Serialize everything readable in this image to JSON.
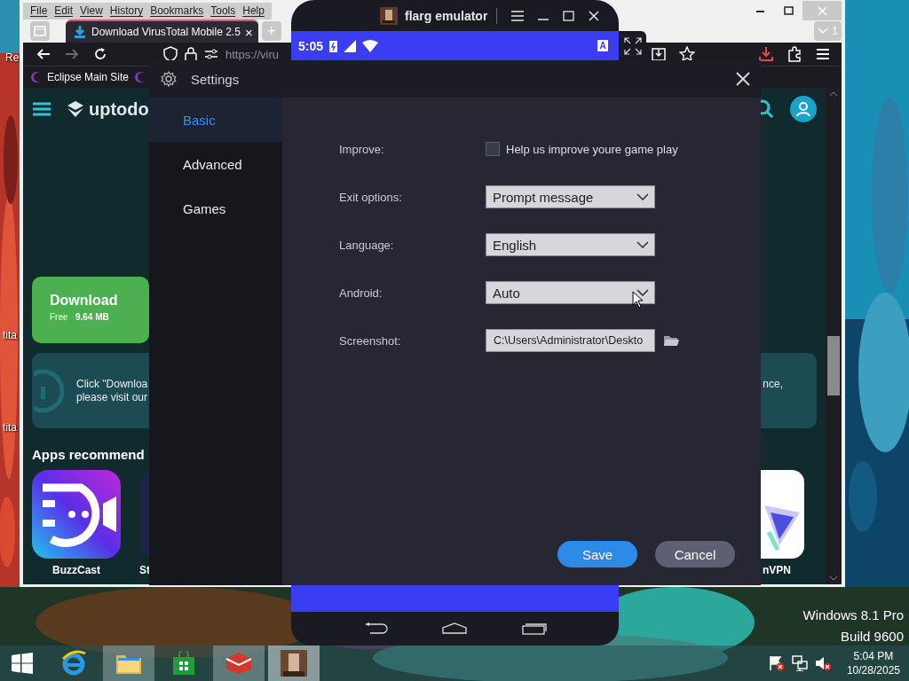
{
  "desktop": {
    "icon_labels": [
      "Re",
      "tita",
      "tita"
    ],
    "edition": "Windows 8.1 Pro",
    "build": "Build 9600"
  },
  "browser": {
    "menu": [
      "File",
      "Edit",
      "View",
      "History",
      "Bookmarks",
      "Tools",
      "Help"
    ],
    "tabs": [
      {
        "title": "Download VirusTotal Mobile 2.5",
        "close": "×",
        "selected": true
      }
    ],
    "new_tab": "+",
    "tab_count": "1",
    "url": "https://viru",
    "bookmarks": [
      "Eclipse Main Site"
    ],
    "page": {
      "logo": "uptodo",
      "download": {
        "label": "Download",
        "price": "Free",
        "size": "9.64 MB"
      },
      "notice": [
        "Click \"Downloa",
        "please visit our"
      ],
      "notice_tail": "nce,",
      "section_title": "Apps recommend",
      "apps": [
        "BuzzCast",
        "St",
        "nVPN"
      ]
    }
  },
  "emulator": {
    "title": "flarg emulator",
    "status_time": "5:05",
    "keyboard_badge": "A"
  },
  "settings": {
    "title": "Settings",
    "nav": [
      {
        "label": "Basic",
        "selected": true
      },
      {
        "label": "Advanced",
        "selected": false
      },
      {
        "label": "Games",
        "selected": false
      }
    ],
    "rows": [
      {
        "kind": "checkbox",
        "label": "Improve:",
        "text": "Help us improve youre game play",
        "checked": false
      },
      {
        "kind": "dropdown",
        "label": "Exit options:",
        "value": "Prompt message"
      },
      {
        "kind": "dropdown",
        "label": "Language:",
        "value": "English"
      },
      {
        "kind": "dropdown",
        "label": "Android:",
        "value": "Auto"
      },
      {
        "kind": "path",
        "label": "Screenshot:",
        "value": "C:\\Users\\Administrator\\Deskto"
      }
    ],
    "buttons": [
      {
        "kind": "primary",
        "label": "Save"
      },
      {
        "kind": "secondary",
        "label": "Cancel"
      }
    ]
  },
  "taskbar": {
    "clock": {
      "time": "5:04 PM",
      "date": "10/28/2025"
    }
  }
}
